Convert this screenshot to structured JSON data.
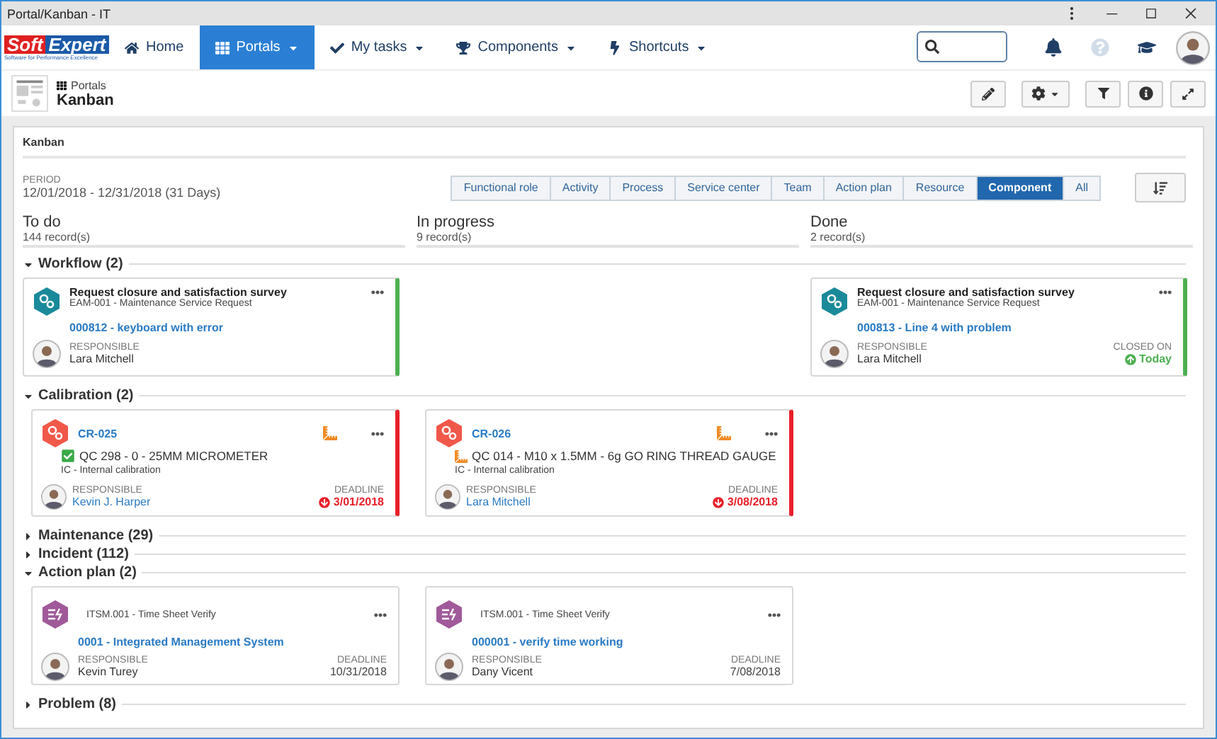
{
  "window": {
    "title": "Portal/Kanban - IT"
  },
  "logo": {
    "name_left": "Soft",
    "name_right": "Expert",
    "tagline": "Software for Performance Excellence"
  },
  "nav": [
    {
      "label": "Home",
      "selected": false,
      "dropdown": false
    },
    {
      "label": "Portals",
      "selected": true,
      "dropdown": true
    },
    {
      "label": "My tasks",
      "selected": false,
      "dropdown": true
    },
    {
      "label": "Components",
      "selected": false,
      "dropdown": true
    },
    {
      "label": "Shortcuts",
      "selected": false,
      "dropdown": true
    }
  ],
  "page": {
    "breadcrumb": "Portals",
    "title": "Kanban"
  },
  "panel": {
    "title": "Kanban",
    "period_label": "PERIOD",
    "period": "12/01/2018 - 12/31/2018 (31 Days)"
  },
  "filters": [
    {
      "label": "Functional role",
      "selected": false
    },
    {
      "label": "Activity",
      "selected": false
    },
    {
      "label": "Process",
      "selected": false
    },
    {
      "label": "Service center",
      "selected": false
    },
    {
      "label": "Team",
      "selected": false
    },
    {
      "label": "Action plan",
      "selected": false
    },
    {
      "label": "Resource",
      "selected": false
    },
    {
      "label": "Component",
      "selected": true
    },
    {
      "label": "All",
      "selected": false
    }
  ],
  "lanes": [
    {
      "title": "To do",
      "count": "144 record(s)"
    },
    {
      "title": "In progress",
      "count": "9 record(s)"
    },
    {
      "title": "Done",
      "count": "2 record(s)"
    }
  ],
  "groups": [
    {
      "label": "Workflow (2)",
      "expanded": true,
      "to_do": [
        {
          "kind": "workflow",
          "title": "Request closure and satisfaction survey",
          "subtitle": "EAM-001 - Maintenance Service Request",
          "link": "000812 - keyboard with error",
          "person_label": "RESPONSIBLE",
          "person": "Lara Mitchell"
        }
      ],
      "done": [
        {
          "kind": "workflow",
          "title": "Request closure and satisfaction survey",
          "subtitle": "EAM-001 - Maintenance Service Request",
          "link": "000813 - Line 4 with problem",
          "person_label": "RESPONSIBLE",
          "person": "Lara Mitchell",
          "date": {
            "kind": "closed",
            "label": "CLOSED ON",
            "value": "Today"
          }
        }
      ]
    },
    {
      "label": "Calibration (2)",
      "expanded": true,
      "to_do": [
        {
          "kind": "calibration",
          "link": "CR-025",
          "item": {
            "text": "QC 298 - 0 - 25MM MICROMETER",
            "kind": "approved"
          },
          "subtitle": "IC - Internal calibration",
          "person_label": "RESPONSIBLE",
          "person": "Kevin J. Harper",
          "date": {
            "kind": "deadline",
            "label": "DEADLINE",
            "value": "3/01/2018",
            "overdue": true
          }
        }
      ],
      "in_progress": [
        {
          "kind": "calibration",
          "link": "CR-026",
          "item": {
            "text": "QC 014 - M10 x 1.5MM - 6g GO RING THREAD GAUGE",
            "kind": "tool"
          },
          "subtitle": "IC - Internal calibration",
          "person_label": "RESPONSIBLE",
          "person": "Lara Mitchell",
          "date": {
            "kind": "deadline",
            "label": "DEADLINE",
            "value": "3/08/2018",
            "overdue": true
          }
        }
      ]
    },
    {
      "label": "Maintenance (29)",
      "expanded": false
    },
    {
      "label": "Incident (112)",
      "expanded": false
    },
    {
      "label": "Action plan (2)",
      "expanded": true,
      "to_do": [
        {
          "kind": "action",
          "subtitle": "ITSM.001 - Time Sheet Verify",
          "link": "0001 - Integrated Management System",
          "person_label": "RESPONSIBLE",
          "person": "Kevin Turey",
          "date": {
            "kind": "deadline",
            "label": "DEADLINE",
            "value": "10/31/2018",
            "overdue": false
          }
        }
      ],
      "in_progress": [
        {
          "kind": "action",
          "subtitle": "ITSM.001 - Time Sheet Verify",
          "link": "000001 - verify time working",
          "person_label": "RESPONSIBLE",
          "person": "Dany Vicent",
          "date": {
            "kind": "deadline",
            "label": "DEADLINE",
            "value": "7/08/2018",
            "overdue": false
          }
        }
      ]
    },
    {
      "label": "Problem (8)",
      "expanded": false
    }
  ]
}
